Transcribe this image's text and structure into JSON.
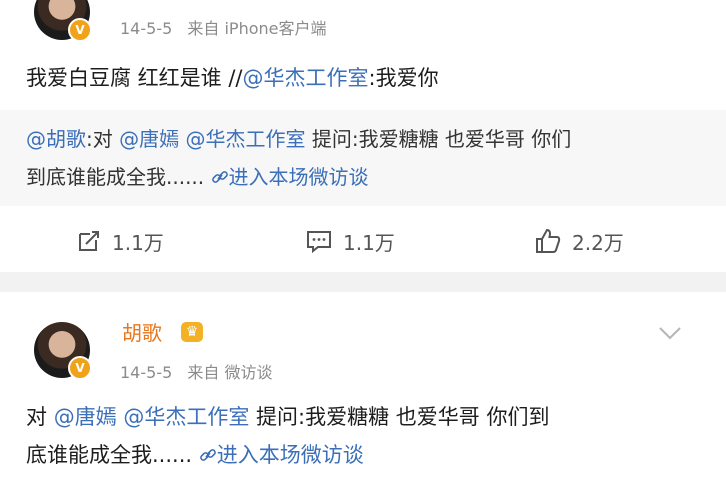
{
  "post1": {
    "timestamp": "14-5-5",
    "source_prefix": "来自",
    "source": "iPhone客户端",
    "text_plain1": "我爱白豆腐 红红是谁 //",
    "mention_huajie": "@华杰工作室",
    "text_plain2": ":我爱你",
    "quote": {
      "mention_huge": "@胡歌",
      "part1": ":对 ",
      "mention_tangyan": "@唐嫣",
      "space": " ",
      "mention_huajie": "@华杰工作室",
      "part2": " 提问:我爱糖糖 也爱华哥 你们",
      "line2": "到底谁能成全我......",
      "link": "进入本场微访谈"
    },
    "actions": {
      "repost_count": "1.1万",
      "comment_count": "1.1万",
      "like_count": "2.2万"
    }
  },
  "post2": {
    "username": "胡歌",
    "timestamp": "14-5-5",
    "source_prefix": "来自",
    "source": "微访谈",
    "text_prefix": "对 ",
    "mention_tangyan": "@唐嫣",
    "space": " ",
    "mention_huajie": "@华杰工作室",
    "text_rest": " 提问:我爱糖糖 也爱华哥 你们到",
    "line2": "底谁能成全我......",
    "link": "进入本场微访谈"
  },
  "colors": {
    "link_blue": "#3b6fb8",
    "username_orange": "#e8781e",
    "badge_gold": "#f0a21a"
  },
  "icons": [
    "verified-badge-icon",
    "crown-vip-icon",
    "chevron-down-icon",
    "link-icon",
    "repost-icon",
    "comment-icon",
    "like-icon"
  ]
}
